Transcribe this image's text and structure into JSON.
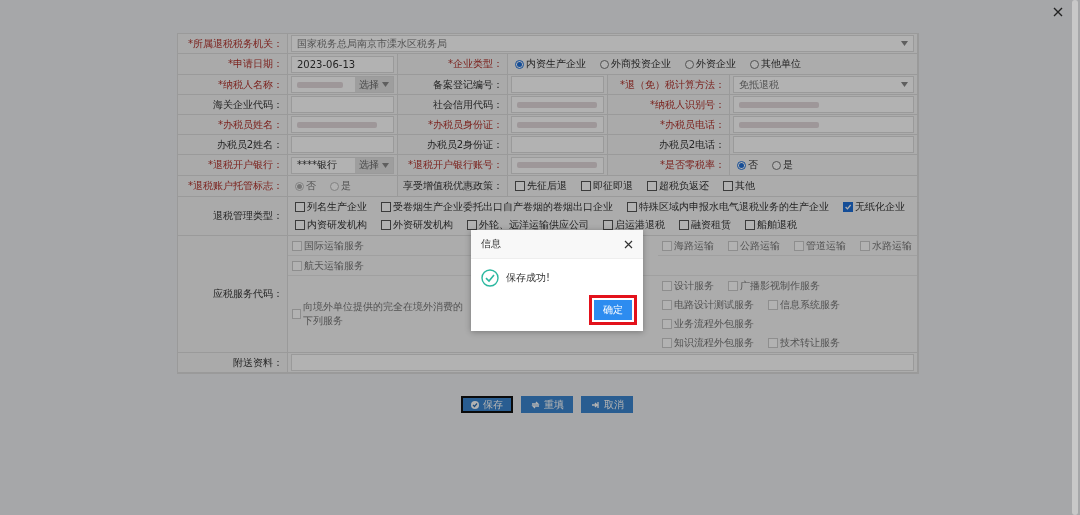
{
  "form": {
    "rows": [
      {
        "cells": [
          {
            "label": "*所属退税税务机关：",
            "required": true,
            "field": {
              "kind": "select",
              "value": "国家税务总局南京市溧水区税务局"
            }
          }
        ]
      },
      {
        "cells": [
          {
            "label": "*申请日期：",
            "required": true,
            "field": {
              "kind": "text",
              "value": "2023-06-13"
            }
          },
          {
            "label": "*企业类型：",
            "required": true,
            "field": {
              "kind": "radio",
              "options": [
                {
                  "label": "内资生产企业",
                  "selected": true,
                  "disabled": false
                },
                {
                  "label": "外商投资企业",
                  "selected": false,
                  "disabled": false
                },
                {
                  "label": "外资企业",
                  "selected": false,
                  "disabled": false
                },
                {
                  "label": "其他单位",
                  "selected": false,
                  "disabled": false
                }
              ]
            }
          }
        ]
      },
      {
        "cells": [
          {
            "label": "*纳税人名称：",
            "required": true,
            "field": {
              "kind": "picker",
              "redacted": true,
              "button": "选择"
            }
          },
          {
            "label": "备案登记编号：",
            "required": false,
            "field": {
              "kind": "text"
            }
          },
          {
            "label": "*退（免）税计算方法：",
            "required": true,
            "field": {
              "kind": "select",
              "value": "免抵退税"
            }
          }
        ]
      },
      {
        "cells": [
          {
            "label": "海关企业代码：",
            "required": false,
            "field": {
              "kind": "text"
            }
          },
          {
            "label": "社会信用代码：",
            "required": false,
            "field": {
              "kind": "text",
              "redacted": true
            }
          },
          {
            "label": "*纳税人识别号：",
            "required": true,
            "field": {
              "kind": "text",
              "redacted": true
            }
          }
        ]
      },
      {
        "cells": [
          {
            "label": "*办税员姓名：",
            "required": true,
            "field": {
              "kind": "text",
              "redacted": true
            }
          },
          {
            "label": "*办税员身份证：",
            "required": true,
            "field": {
              "kind": "text",
              "redacted": true
            }
          },
          {
            "label": "*办税员电话：",
            "required": true,
            "field": {
              "kind": "text",
              "redacted": true
            }
          }
        ]
      },
      {
        "cells": [
          {
            "label": "办税员2姓名：",
            "required": false,
            "field": {
              "kind": "text"
            }
          },
          {
            "label": "办税员2身份证：",
            "required": false,
            "field": {
              "kind": "text"
            }
          },
          {
            "label": "办税员2电话：",
            "required": false,
            "field": {
              "kind": "text"
            }
          }
        ]
      },
      {
        "cells": [
          {
            "label": "*退税开户银行：",
            "required": true,
            "field": {
              "kind": "picker",
              "value": "****银行",
              "button": "选择"
            }
          },
          {
            "label": "*退税开户银行账号：",
            "required": true,
            "field": {
              "kind": "text",
              "redacted": true
            }
          },
          {
            "label": "*是否零税率：",
            "required": true,
            "field": {
              "kind": "radio",
              "options": [
                {
                  "label": "否",
                  "selected": true,
                  "disabled": false
                },
                {
                  "label": "是",
                  "selected": false,
                  "disabled": false
                }
              ]
            }
          }
        ]
      },
      {
        "cells": [
          {
            "label": "*退税账户托管标志：",
            "required": true,
            "field": {
              "kind": "radio",
              "options": [
                {
                  "label": "否",
                  "selected": true,
                  "disabled": true
                },
                {
                  "label": "是",
                  "selected": false,
                  "disabled": true
                }
              ]
            }
          },
          {
            "label": "享受增值税优惠政策：",
            "required": false,
            "field": {
              "kind": "checks",
              "options": [
                {
                  "label": "先征后退",
                  "checked": false,
                  "disabled": false
                },
                {
                  "label": "即征即退",
                  "checked": false,
                  "disabled": false
                },
                {
                  "label": "超税负返还",
                  "checked": false,
                  "disabled": false
                },
                {
                  "label": "其他",
                  "checked": false,
                  "disabled": false
                }
              ]
            }
          }
        ]
      },
      {
        "cells": [
          {
            "label": "退税管理类型：",
            "required": false,
            "field": {
              "kind": "checks",
              "options": [
                {
                  "label": "列名生产企业",
                  "checked": false,
                  "disabled": false
                },
                {
                  "label": "受卷烟生产企业委托出口自产卷烟的卷烟出口企业",
                  "checked": false,
                  "disabled": false
                },
                {
                  "label": "特殊区域内申报水电气退税业务的生产企业",
                  "checked": false,
                  "disabled": false
                },
                {
                  "label": "无纸化企业",
                  "checked": true,
                  "disabled": false
                },
                {
                  "label": "内资研发机构",
                  "checked": false,
                  "disabled": false
                },
                {
                  "label": "外资研发机构",
                  "checked": false,
                  "disabled": false
                },
                {
                  "label": "外轮、远洋运输供应公司",
                  "checked": false,
                  "disabled": false
                },
                {
                  "label": "启运港退税",
                  "checked": false,
                  "disabled": false
                },
                {
                  "label": "融资租赁",
                  "checked": false,
                  "disabled": false
                },
                {
                  "label": "船舶退税",
                  "checked": false,
                  "disabled": false
                }
              ]
            }
          }
        ]
      },
      {
        "cells": [
          {
            "label": "应税服务代码：",
            "required": false,
            "field": {
              "kind": "services",
              "lines": [
                {
                  "kind": "covered",
                  "before": [
                    {
                      "label": "国际运输服务",
                      "checked": false,
                      "disabled": true
                    }
                  ],
                  "after": [
                    {
                      "label": "海路运输",
                      "checked": false,
                      "disabled": true
                    },
                    {
                      "label": "公路运输",
                      "checked": false,
                      "disabled": true
                    },
                    {
                      "label": "管道运输",
                      "checked": false,
                      "disabled": true
                    },
                    {
                      "label": "水路运输",
                      "checked": false,
                      "disabled": true
                    }
                  ]
                },
                {
                  "kind": "plain",
                  "items": [
                    {
                      "label": "航天运输服务",
                      "checked": false,
                      "disabled": true
                    }
                  ]
                },
                {
                  "kind": "split",
                  "item": {
                    "label": "向境外单位提供的完全在境外消费的下列服务",
                    "checked": false,
                    "disabled": true
                  },
                  "lines": [
                    {
                      "items": [
                        {
                          "label": "设计服务",
                          "checked": false,
                          "disabled": true
                        },
                        {
                          "label": "广播影视制作服务",
                          "checked": false,
                          "disabled": true
                        }
                      ]
                    },
                    {
                      "items": [
                        {
                          "label": "电路设计测试服务",
                          "checked": false,
                          "disabled": true
                        },
                        {
                          "label": "信息系统服务",
                          "checked": false,
                          "disabled": true
                        }
                      ]
                    },
                    {
                      "items": [
                        {
                          "label": "业务流程外包服务",
                          "checked": false,
                          "disabled": true
                        }
                      ]
                    },
                    {
                      "items": [
                        {
                          "label": "知识流程外包服务",
                          "checked": false,
                          "disabled": true
                        },
                        {
                          "label": "技术转让服务",
                          "checked": false,
                          "disabled": true
                        }
                      ]
                    }
                  ]
                }
              ]
            }
          }
        ]
      },
      {
        "cells": [
          {
            "label": "附送资料：",
            "required": false,
            "field": {
              "kind": "text"
            }
          }
        ]
      }
    ]
  },
  "dialog": {
    "title": "信息",
    "kind": "success",
    "message": "保存成功!",
    "button": {
      "label": "确定",
      "highlighted": true
    }
  },
  "actions": [
    {
      "kind": "save",
      "label": "保存",
      "focused": true
    },
    {
      "kind": "reset",
      "label": "重填",
      "focused": false
    },
    {
      "kind": "cancel",
      "label": "取消",
      "focused": false
    }
  ]
}
